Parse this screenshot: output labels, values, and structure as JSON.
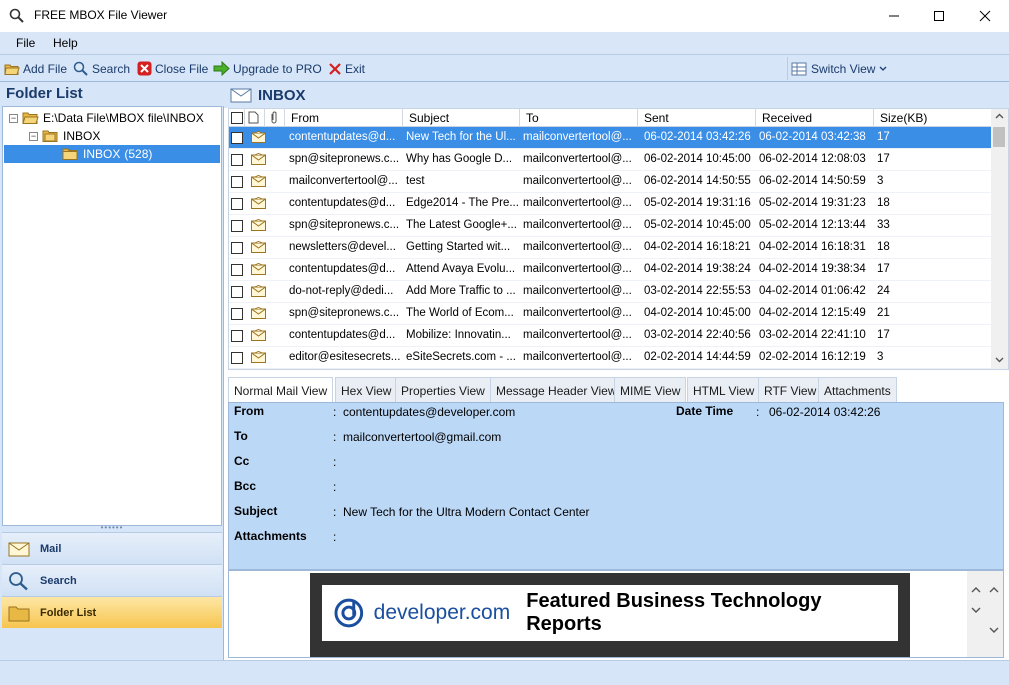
{
  "window": {
    "title": "FREE MBOX File Viewer"
  },
  "menu": {
    "file": "File",
    "help": "Help"
  },
  "toolbar": {
    "add_file": "Add File",
    "search": "Search",
    "close_file": "Close File",
    "upgrade": "Upgrade to PRO",
    "exit": "Exit",
    "switch_view": "Switch View"
  },
  "folder_list": {
    "header": "Folder List",
    "root": "E:\\Data File\\MBOX file\\INBOX",
    "child": "INBOX",
    "selected": "INBOX",
    "selected_count": "(528)"
  },
  "nav": {
    "mail": "Mail",
    "search": "Search",
    "folder_list": "Folder List"
  },
  "inbox": {
    "title": "INBOX",
    "columns": {
      "from": "From",
      "subject": "Subject",
      "to": "To",
      "sent": "Sent",
      "received": "Received",
      "size": "Size(KB)"
    },
    "rows": [
      {
        "from": "contentupdates@d...",
        "subject": "New Tech for the Ul...",
        "to": "mailconvertertool@...",
        "sent": "06-02-2014 03:42:26",
        "received": "06-02-2014 03:42:38",
        "size": "17"
      },
      {
        "from": "spn@sitepronews.c...",
        "subject": "Why has Google D...",
        "to": "mailconvertertool@...",
        "sent": "06-02-2014 10:45:00",
        "received": "06-02-2014 12:08:03",
        "size": "17"
      },
      {
        "from": "mailconvertertool@...",
        "subject": "test",
        "to": "mailconvertertool@...",
        "sent": "06-02-2014 14:50:55",
        "received": "06-02-2014 14:50:59",
        "size": "3"
      },
      {
        "from": "contentupdates@d...",
        "subject": "Edge2014 - The Pre...",
        "to": "mailconvertertool@...",
        "sent": "05-02-2014 19:31:16",
        "received": "05-02-2014 19:31:23",
        "size": "18"
      },
      {
        "from": "spn@sitepronews.c...",
        "subject": "The Latest Google+...",
        "to": "mailconvertertool@...",
        "sent": "05-02-2014 10:45:00",
        "received": "05-02-2014 12:13:44",
        "size": "33"
      },
      {
        "from": "newsletters@devel...",
        "subject": "Getting Started wit...",
        "to": "mailconvertertool@...",
        "sent": "04-02-2014 16:18:21",
        "received": "04-02-2014 16:18:31",
        "size": "18"
      },
      {
        "from": "contentupdates@d...",
        "subject": "Attend Avaya Evolu...",
        "to": "mailconvertertool@...",
        "sent": "04-02-2014 19:38:24",
        "received": "04-02-2014 19:38:34",
        "size": "17"
      },
      {
        "from": "do-not-reply@dedi...",
        "subject": "Add More Traffic to ...",
        "to": "mailconvertertool@...",
        "sent": "03-02-2014 22:55:53",
        "received": "04-02-2014 01:06:42",
        "size": "24"
      },
      {
        "from": "spn@sitepronews.c...",
        "subject": "The World of Ecom...",
        "to": "mailconvertertool@...",
        "sent": "04-02-2014 10:45:00",
        "received": "04-02-2014 12:15:49",
        "size": "21"
      },
      {
        "from": "contentupdates@d...",
        "subject": "Mobilize: Innovatin...",
        "to": "mailconvertertool@...",
        "sent": "03-02-2014 22:40:56",
        "received": "03-02-2014 22:41:10",
        "size": "17"
      },
      {
        "from": "editor@esitesecrets....",
        "subject": "eSiteSecrets.com - ...",
        "to": "mailconvertertool@...",
        "sent": "02-02-2014 14:44:59",
        "received": "02-02-2014 16:12:19",
        "size": "3"
      }
    ]
  },
  "tabs": [
    "Normal Mail View",
    "Hex View",
    "Properties View",
    "Message Header View",
    "MIME View",
    "HTML View",
    "RTF View",
    "Attachments"
  ],
  "details": {
    "from_label": "From",
    "from_value": "contentupdates@developer.com",
    "datetime_label": "Date Time",
    "datetime_value": "06-02-2014 03:42:26",
    "to_label": "To",
    "to_value": "mailconvertertool@gmail.com",
    "cc_label": "Cc",
    "bcc_label": "Bcc",
    "subject_label": "Subject",
    "subject_value": "New Tech for the Ultra Modern Contact Center",
    "attachments_label": "Attachments",
    "colon": ":"
  },
  "preview": {
    "logo": "developer.com",
    "title": "Featured Business Technology Reports"
  }
}
